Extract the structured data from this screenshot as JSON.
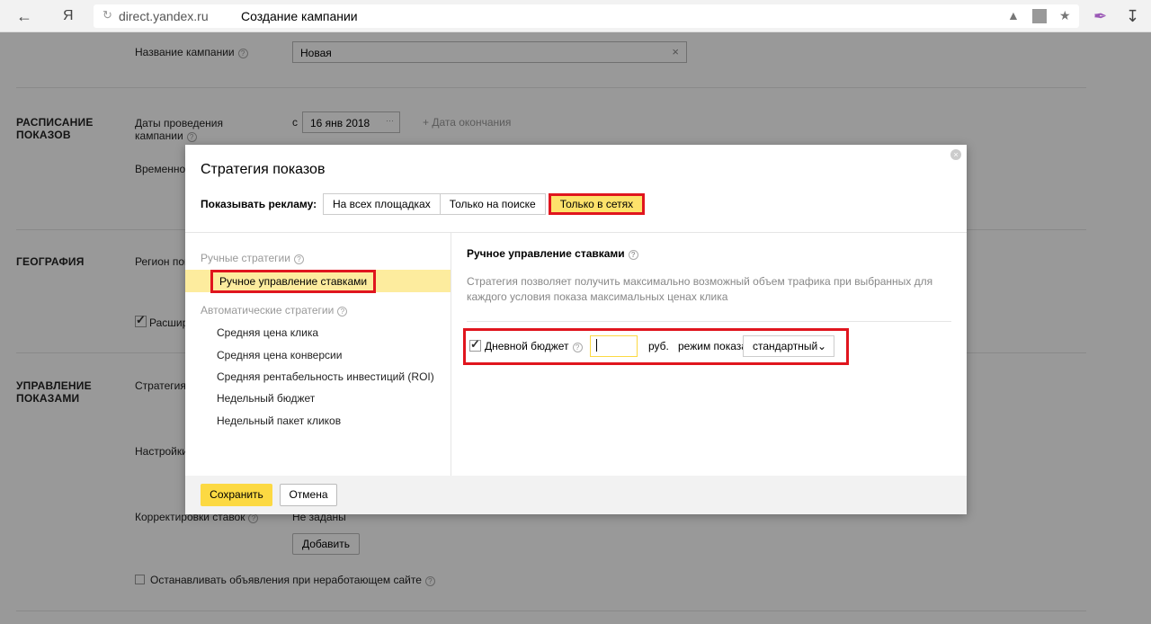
{
  "browser": {
    "back_icon": "back-arrow-icon",
    "logo": "Я",
    "domain": "direct.yandex.ru",
    "page_title": "Создание кампании"
  },
  "page": {
    "campaign_name_label": "Название кампании",
    "campaign_name_value": "Новая",
    "schedule_section": "РАСПИСАНИЕ ПОКАЗОВ",
    "dates_label": "Даты проведения кампании",
    "date_prefix": "с",
    "date_start": "16 янв 2018",
    "date_end_link": "Дата окончания",
    "time_label": "Временно",
    "geo_section": "ГЕОГРАФИЯ",
    "region_label": "Регион пок",
    "extended_label": "Расшир",
    "manage_section": "УПРАВЛЕНИЕ ПОКАЗАМИ",
    "strategy_label": "Стратегия",
    "settings_label": "Настройки",
    "bid_adjust_label": "Корректировки ставок",
    "bid_adjust_value": "Не заданы",
    "add_button": "Добавить",
    "stop_ads_label": "Останавливать объявления при неработающем сайте"
  },
  "modal": {
    "title": "Стратегия показов",
    "show_ads_label": "Показывать рекламу:",
    "tabs": [
      "На всех площадках",
      "Только на поиске",
      "Только в сетях"
    ],
    "active_tab": 2,
    "manual_header": "Ручные стратегии",
    "manual_item": "Ручное управление ставками",
    "auto_header": "Автоматические стратегии",
    "auto_items": [
      "Средняя цена клика",
      "Средняя цена конверсии",
      "Средняя рентабельность инвестиций (ROI)",
      "Недельный бюджет",
      "Недельный пакет кликов"
    ],
    "right_title": "Ручное управление ставками",
    "right_desc": "Стратегия позволяет получить максимально возможный объем трафика при выбранных для каждого условия показа максимальных ценах клика",
    "daily_budget_label": "Дневной бюджет",
    "daily_budget_value": "",
    "currency_label": "руб.",
    "mode_label": "режим показа",
    "mode_value": "стандартный",
    "save_button": "Сохранить",
    "cancel_button": "Отмена"
  },
  "colors": {
    "accent_yellow": "#fcd942",
    "highlight_red": "#e0151e",
    "active_row": "#fdec9e"
  }
}
